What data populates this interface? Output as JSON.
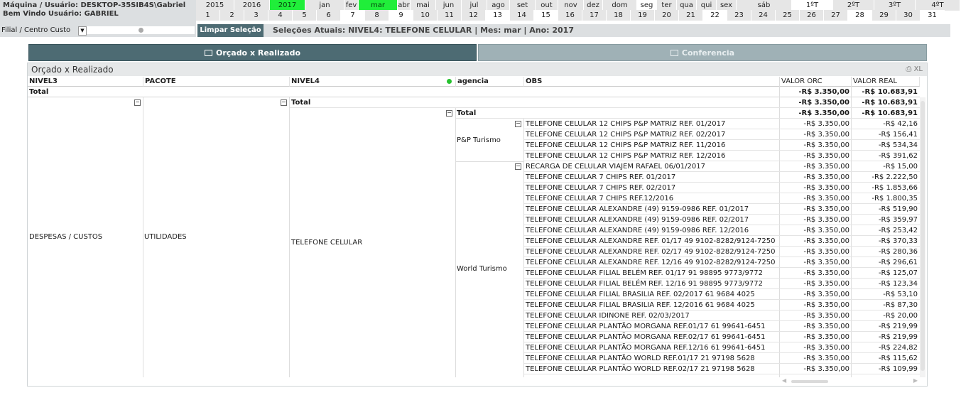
{
  "header": {
    "machine_line": "Máquina / Usuário: DESKTOP-35SIB4S\\Gabriel",
    "welcome_line": "Bem Vindo Usuário: GABRIEL",
    "filial_label": "Filial / Centro Custo"
  },
  "calendar": {
    "top_row": [
      {
        "label": "2015",
        "state": "normal"
      },
      {
        "label": "2016",
        "state": "normal"
      },
      {
        "label": "2017",
        "state": "selected"
      },
      {
        "label": "jan",
        "state": "normal"
      },
      {
        "label": "fev",
        "state": "normal"
      },
      {
        "label": "mar",
        "state": "selected"
      },
      {
        "label": "abr",
        "state": "normal"
      },
      {
        "label": "mai",
        "state": "normal"
      },
      {
        "label": "jun",
        "state": "normal"
      },
      {
        "label": "jul",
        "state": "normal"
      },
      {
        "label": "ago",
        "state": "normal"
      },
      {
        "label": "set",
        "state": "normal"
      },
      {
        "label": "out",
        "state": "normal"
      },
      {
        "label": "nov",
        "state": "normal"
      },
      {
        "label": "dez",
        "state": "normal"
      },
      {
        "label": "dom",
        "state": "normal"
      },
      {
        "label": "seg",
        "state": "white"
      },
      {
        "label": "ter",
        "state": "normal"
      },
      {
        "label": "qua",
        "state": "normal"
      },
      {
        "label": "qui",
        "state": "normal"
      },
      {
        "label": "sex",
        "state": "normal"
      },
      {
        "label": "sáb",
        "state": "normal"
      },
      {
        "label": "1ºT",
        "state": "white"
      },
      {
        "label": "2ºT",
        "state": "normal"
      },
      {
        "label": "3ºT",
        "state": "normal"
      },
      {
        "label": "4ºT",
        "state": "normal"
      }
    ],
    "days": [
      "1",
      "2",
      "3",
      "4",
      "5",
      "6",
      "7",
      "8",
      "9",
      "10",
      "11",
      "12",
      "13",
      "14",
      "15",
      "16",
      "17",
      "18",
      "19",
      "20",
      "21",
      "22",
      "23",
      "24",
      "25",
      "26",
      "27",
      "28",
      "29",
      "30",
      "31"
    ],
    "white_days": [
      "7",
      "9",
      "13",
      "15",
      "22",
      "28",
      "31"
    ]
  },
  "selection_bar": {
    "clear_button": "Limpar Seleção",
    "current": "Seleções Atuais: NIVEL4: TELEFONE CELULAR | Mes: mar | Ano: 2017"
  },
  "tabs": [
    {
      "label": "Orçado x Realizado",
      "active": true
    },
    {
      "label": "Conferencia",
      "active": false
    }
  ],
  "panel": {
    "title": "Orçado x Realizado",
    "xl_label": "XL"
  },
  "table": {
    "columns": [
      "NIVEL3",
      "PACOTE",
      "NIVEL4",
      "agencia",
      "OBS",
      "VALOR ORC",
      "VALOR REAL"
    ],
    "total_label": "Total",
    "grand_total": {
      "orc": "-R$ 3.350,00",
      "real": "-R$ 10.683,91"
    },
    "nivel3": "DESPESAS / CUSTOS",
    "pacote": "UTILIDADES",
    "nivel4": "TELEFONE CELULAR",
    "agencies": [
      {
        "name": "P&P Turismo",
        "rows": [
          {
            "obs": "TELEFONE CELULAR 12 CHIPS P&P MATRIZ REF. 01/2017",
            "orc": "-R$ 3.350,00",
            "real": "-R$ 42,16"
          },
          {
            "obs": "TELEFONE CELULAR 12 CHIPS P&P MATRIZ REF. 02/2017",
            "orc": "-R$ 3.350,00",
            "real": "-R$ 156,41"
          },
          {
            "obs": "TELEFONE CELULAR 12 CHIPS P&P MATRIZ REF. 11/2016",
            "orc": "-R$ 3.350,00",
            "real": "-R$ 534,34"
          },
          {
            "obs": "TELEFONE CELULAR 12 CHIPS P&P MATRIZ REF. 12/2016",
            "orc": "-R$ 3.350,00",
            "real": "-R$ 391,62"
          }
        ]
      },
      {
        "name": "World Turismo",
        "rows": [
          {
            "obs": "RECARGA DE CELULAR VIAJEM RAFAEL 06/01/2017",
            "orc": "-R$ 3.350,00",
            "real": "-R$ 15,00"
          },
          {
            "obs": "TELEFONE CELULAR 7 CHIPS REF. 01/2017",
            "orc": "-R$ 3.350,00",
            "real": "-R$ 2.222,50"
          },
          {
            "obs": "TELEFONE CELULAR 7 CHIPS REF. 02/2017",
            "orc": "-R$ 3.350,00",
            "real": "-R$ 1.853,66"
          },
          {
            "obs": "TELEFONE CELULAR 7 CHIPS REF.12/2016",
            "orc": "-R$ 3.350,00",
            "real": "-R$ 1.800,35"
          },
          {
            "obs": "TELEFONE CELULAR ALEXANDRE (49) 9159-0986 REF. 01/2017",
            "orc": "-R$ 3.350,00",
            "real": "-R$ 519,90"
          },
          {
            "obs": "TELEFONE CELULAR ALEXANDRE (49) 9159-0986 REF. 02/2017",
            "orc": "-R$ 3.350,00",
            "real": "-R$ 359,97"
          },
          {
            "obs": "TELEFONE CELULAR ALEXANDRE (49) 9159-0986 REF. 12/2016",
            "orc": "-R$ 3.350,00",
            "real": "-R$ 253,42"
          },
          {
            "obs": "TELEFONE CELULAR ALEXANDRE REF. 01/17 49 9102-8282/9124-7250",
            "orc": "-R$ 3.350,00",
            "real": "-R$ 370,33"
          },
          {
            "obs": "TELEFONE CELULAR ALEXANDRE REF. 02/17 49 9102-8282/9124-7250",
            "orc": "-R$ 3.350,00",
            "real": "-R$ 280,36"
          },
          {
            "obs": "TELEFONE CELULAR ALEXANDRE REF. 12/16 49 9102-8282/9124-7250",
            "orc": "-R$ 3.350,00",
            "real": "-R$ 296,61"
          },
          {
            "obs": "TELEFONE CELULAR FILIAL BELÉM REF. 01/17 91 98895 9773/9772",
            "orc": "-R$ 3.350,00",
            "real": "-R$ 125,07"
          },
          {
            "obs": "TELEFONE CELULAR FILIAL BELÉM REF. 12/16 91 98895 9773/9772",
            "orc": "-R$ 3.350,00",
            "real": "-R$ 123,34"
          },
          {
            "obs": "TELEFONE CELULAR FILIAL BRASILIA REF. 02/2017 61 9684 4025",
            "orc": "-R$ 3.350,00",
            "real": "-R$ 53,10"
          },
          {
            "obs": "TELEFONE CELULAR FILIAL BRASILIA REF. 12/2016 61 9684 4025",
            "orc": "-R$ 3.350,00",
            "real": "-R$ 87,30"
          },
          {
            "obs": "TELEFONE CELULAR IDINONE REF. 02/03/2017",
            "orc": "-R$ 3.350,00",
            "real": "-R$ 20,00"
          },
          {
            "obs": "TELEFONE CELULAR PLANTÃO MORGANA REF.01/17 61 99641-6451",
            "orc": "-R$ 3.350,00",
            "real": "-R$ 219,99"
          },
          {
            "obs": "TELEFONE CELULAR PLANTÃO MORGANA REF.02/17 61 99641-6451",
            "orc": "-R$ 3.350,00",
            "real": "-R$ 219,99"
          },
          {
            "obs": "TELEFONE CELULAR PLANTÃO MORGANA REF.12/16 61 99641-6451",
            "orc": "-R$ 3.350,00",
            "real": "-R$ 224,82"
          },
          {
            "obs": "TELEFONE CELULAR PLANTÃO WORLD  REF.01/17 21 97198 5628",
            "orc": "-R$ 3.350,00",
            "real": "-R$ 115,62"
          },
          {
            "obs": "TELEFONE CELULAR PLANTÃO WORLD  REF.02/17 21 97198 5628",
            "orc": "-R$ 3.350,00",
            "real": "-R$ 109,99"
          }
        ]
      }
    ]
  },
  "colors": {
    "accent": "#4d6b73",
    "selected_green": "#20ee3a",
    "inactive_tab": "#9fb1b6"
  }
}
